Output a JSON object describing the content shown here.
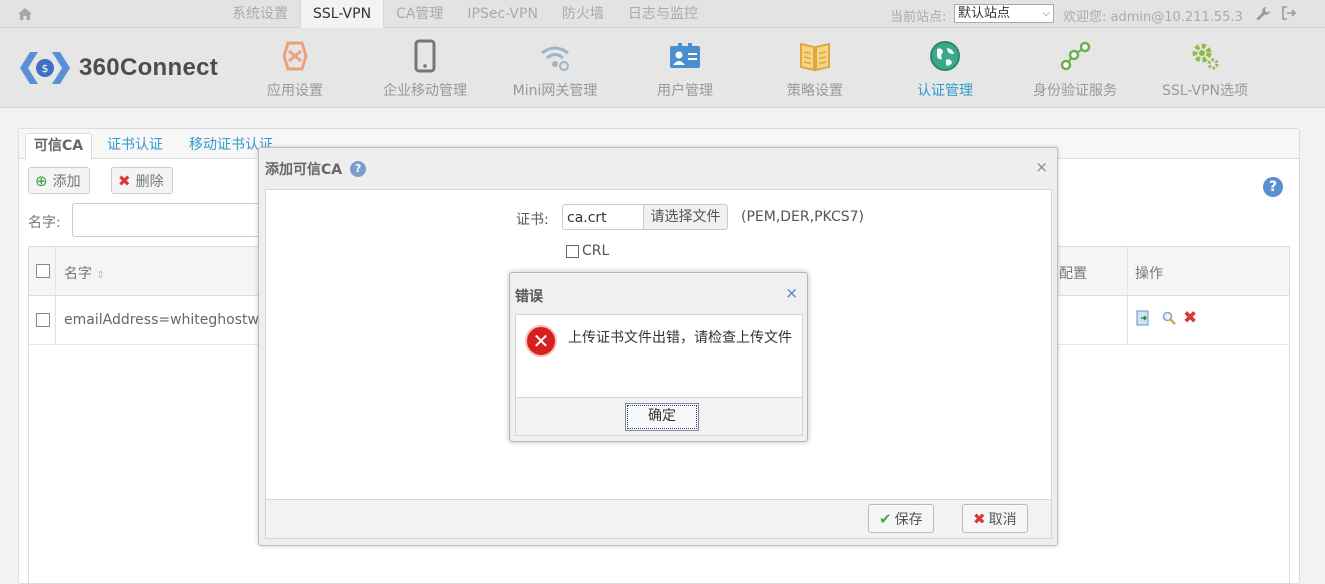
{
  "topbar": {
    "home_icon": "home-icon",
    "nav": [
      "系统设置",
      "SSL-VPN",
      "CA管理",
      "IPSec-VPN",
      "防火墙",
      "日志与监控"
    ],
    "active_nav": "SSL-VPN",
    "site_label": "当前站点:",
    "site_value": "默认站点",
    "welcome": "欢迎您: admin@10.211.55.3"
  },
  "header": {
    "logo_text": "360Connect",
    "modules": [
      {
        "label": "应用设置",
        "icon": "app-settings-icon",
        "color": "#e8a27c"
      },
      {
        "label": "企业移动管理",
        "icon": "mobile-icon",
        "color": "#777777"
      },
      {
        "label": "Mini网关管理",
        "icon": "wifi-icon",
        "color": "#a0b4c8"
      },
      {
        "label": "用户管理",
        "icon": "user-card-icon",
        "color": "#4a8fd0"
      },
      {
        "label": "策略设置",
        "icon": "book-icon",
        "color": "#e8b64a"
      },
      {
        "label": "认证管理",
        "icon": "globe-icon",
        "color": "#3aa88a"
      },
      {
        "label": "身份验证服务",
        "icon": "share-nodes-icon",
        "color": "#6ab04c"
      },
      {
        "label": "SSL-VPN选项",
        "icon": "gear-icon",
        "color": "#8cbe4a"
      }
    ],
    "active_module": "认证管理"
  },
  "panel": {
    "tabs": [
      "可信CA",
      "证书认证",
      "移动证书认证"
    ],
    "add_label": "添加",
    "delete_label": "删除",
    "name_label": "名字:",
    "table": {
      "columns": [
        "名字",
        "配置",
        "操作"
      ],
      "sort_mark": "⇕",
      "rows": [
        {
          "name": "emailAddress=whiteghostwa"
        }
      ]
    }
  },
  "dialog": {
    "title": "添加可信CA",
    "cert_label": "证书:",
    "file_name": "ca.crt",
    "file_button": "请选择文件",
    "formats": "(PEM,DER,PKCS7)",
    "crl_label": "CRL",
    "save_label": "保存",
    "cancel_label": "取消"
  },
  "alert": {
    "title": "错误",
    "message": "上传证书文件出错，请检查上传文件",
    "ok_label": "确定"
  },
  "colors": {
    "accent": "#3399cc",
    "error": "#d62020"
  }
}
